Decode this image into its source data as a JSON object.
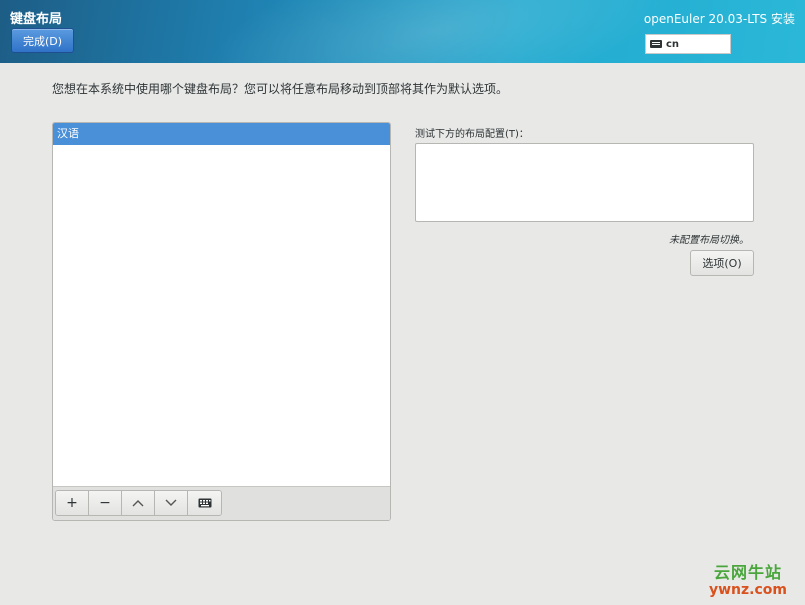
{
  "header": {
    "page_title": "键盘布局",
    "done_label": "完成(D)",
    "product_title": "openEuler 20.03-LTS 安装",
    "layout_indicator": {
      "icon": "keyboard-icon",
      "value": "cn"
    }
  },
  "main": {
    "instruction": "您想在本系统中使用哪个键盘布局？您可以将任意布局移动到顶部将其作为默认选项。",
    "layouts": [
      {
        "label": "汉语",
        "selected": true
      }
    ],
    "toolbar": {
      "add_label": "+",
      "remove_label": "−",
      "up_label": "⌃",
      "down_label": "⌄",
      "preview_icon": "keyboard-icon"
    },
    "test_label": "测试下方的布局配置(T)：",
    "test_value": "",
    "switch_note": "未配置布局切换。",
    "options_label": "选项(O)"
  },
  "watermark": {
    "cn": "云网牛站",
    "en": "ywnz.com"
  },
  "colors": {
    "header_gradient_start": "#1d5d86",
    "header_gradient_end": "#2ab8d8",
    "selection": "#4a90d9",
    "background": "#e8e8e7",
    "watermark_green": "#4aa63c",
    "watermark_orange": "#d9511d"
  }
}
